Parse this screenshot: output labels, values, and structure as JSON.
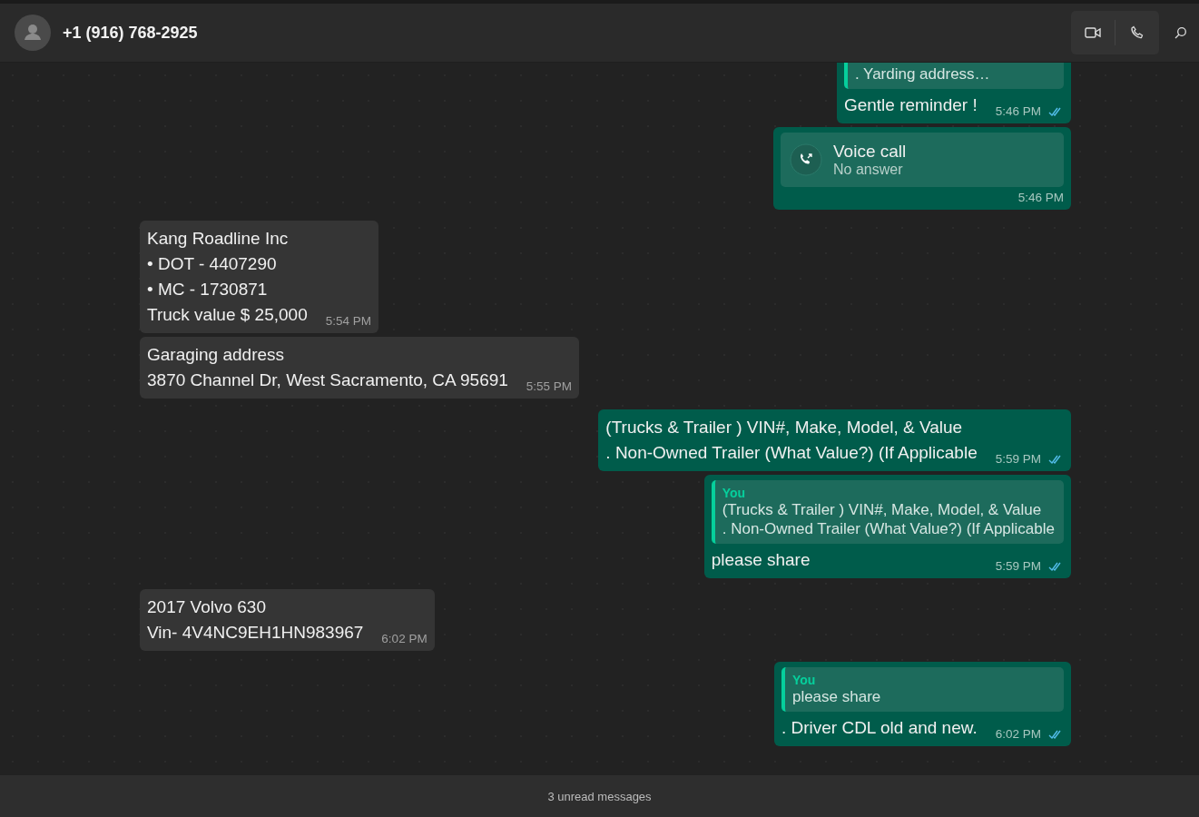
{
  "header": {
    "contact": "+1 (916) 768-2925"
  },
  "messages": [
    {
      "kind": "reply",
      "outgoing": true,
      "quote_lines": [
        ". Yarding address…"
      ],
      "text": [
        "Gentle reminder !"
      ],
      "time": "5:46 PM",
      "read": true
    },
    {
      "kind": "call",
      "outgoing": true,
      "title": "Voice call",
      "subtitle": "No answer",
      "time": "5:46 PM"
    },
    {
      "kind": "text",
      "outgoing": false,
      "text": [
        "Kang Roadline Inc",
        "• DOT - 4407290",
        "• MC - 1730871",
        "Truck value $ 25,000"
      ],
      "time": "5:54 PM"
    },
    {
      "kind": "text",
      "outgoing": false,
      "text": [
        "Garaging address",
        "3870 Channel Dr, West Sacramento, CA 95691"
      ],
      "time": "5:55 PM"
    },
    {
      "kind": "text",
      "outgoing": true,
      "text": [
        "(Trucks & Trailer ) VIN#, Make, Model, & Value",
        ". Non-Owned Trailer (What Value?) (If Applicable"
      ],
      "time": "5:59 PM",
      "read": true
    },
    {
      "kind": "reply",
      "outgoing": true,
      "quote_author": "You",
      "quote_lines": [
        "(Trucks & Trailer ) VIN#, Make, Model, & Value",
        ". Non-Owned Trailer (What Value?) (If Applicable"
      ],
      "text": [
        "please share"
      ],
      "time": "5:59 PM",
      "read": true
    },
    {
      "kind": "text",
      "outgoing": false,
      "text": [
        "2017 Volvo 630",
        "Vin- 4V4NC9EH1HN983967"
      ],
      "time": "6:02 PM"
    },
    {
      "kind": "reply",
      "outgoing": true,
      "quote_author": "You",
      "quote_lines": [
        "please share"
      ],
      "text": [
        ". Driver CDL old and new."
      ],
      "time": "6:02 PM",
      "read": true
    }
  ],
  "unread_banner": "3 unread messages"
}
